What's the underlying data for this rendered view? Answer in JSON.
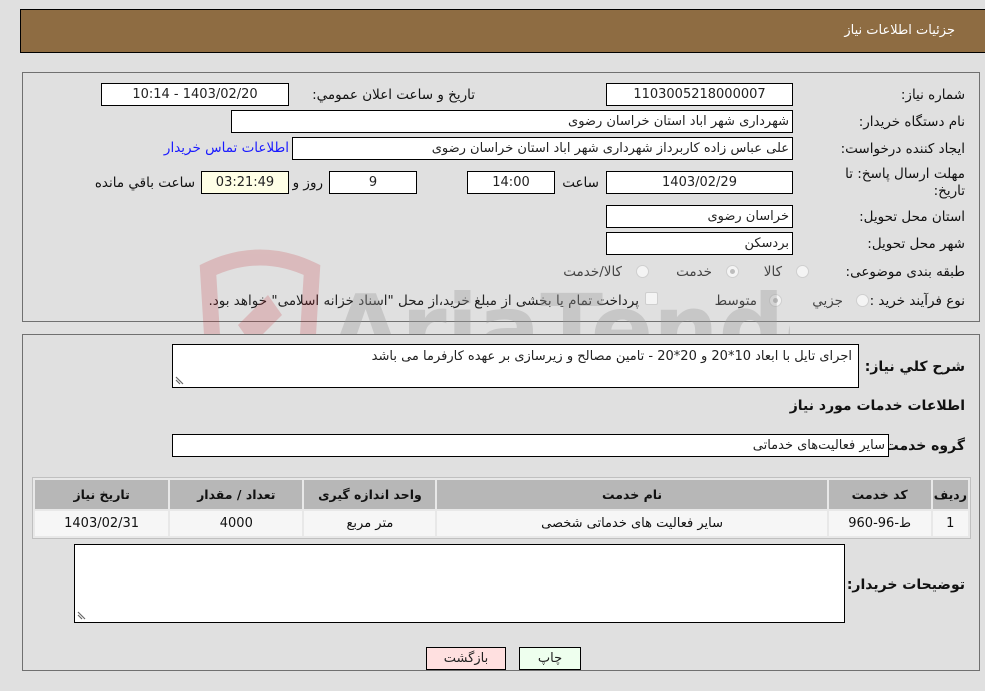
{
  "header": {
    "title": "جزئیات اطلاعات نیاز"
  },
  "form": {
    "need_number": {
      "label": "شماره نیاز:",
      "value": "1103005218000007"
    },
    "announce": {
      "label": "تاریخ و ساعت اعلان عمومي:",
      "value": "1403/02/20 - 10:14"
    },
    "buyer_org": {
      "label": "نام دستگاه خريدار:",
      "value": "شهرداری شهر اباد استان خراسان رضوی"
    },
    "creator": {
      "label": "ایجاد کننده درخواست:",
      "value": "علی عباس زاده کاربرداز شهرداری شهر اباد استان خراسان رضوی",
      "contact_link": "اطلاعات تماس خریدار"
    },
    "deadline": {
      "label": "مهلت ارسال پاسخ: تا تاریخ:",
      "date": "1403/02/29",
      "time_label": "ساعت",
      "time": "14:00",
      "days": "9",
      "days_label": "روز و",
      "remaining": "03:21:49",
      "remaining_label": "ساعت باقي مانده"
    },
    "delivery_province": {
      "label": "استان محل تحویل:",
      "value": "خراسان رضوی"
    },
    "delivery_city": {
      "label": "شهر محل تحویل:",
      "value": "بردسکن"
    },
    "category": {
      "label": "طبقه بندی موضوعی:",
      "options": [
        "کالا",
        "خدمت",
        "کالا/خدمت"
      ],
      "selected": "خدمت"
    },
    "purchase_type": {
      "label": "نوع فرآیند خرید :",
      "options": [
        "جزيي",
        "متوسط"
      ],
      "selected": "متوسط",
      "treasury_note": "پرداخت تمام یا بخشی از مبلغ خرید،از محل \"اسناد خزانه اسلامی\" خواهد بود."
    }
  },
  "details": {
    "description_label": "شرح کلي نياز:",
    "description": "اجرای تایل با ابعاد 10*20 و 20*20 - تامین مصالح و زیرسازی بر عهده کارفرما می باشد",
    "services_heading": "اطلاعات خدمات مورد نياز",
    "service_group_label": "گروه خدمت:",
    "service_group": "سایر فعالیت‌های خدماتی",
    "table": {
      "headers": [
        "ردیف",
        "کد خدمت",
        "نام خدمت",
        "واحد اندازه گیری",
        "تعداد / مقدار",
        "تاریخ نیاز"
      ],
      "rows": [
        [
          "1",
          "ط-96-960",
          "سایر فعالیت های خدماتی شخصی",
          "متر مربع",
          "4000",
          "1403/02/31"
        ]
      ]
    },
    "buyer_notes_label": "توضیحات خریدار:",
    "buyer_notes": ""
  },
  "buttons": {
    "print": "چاپ",
    "back": "بازگشت"
  },
  "watermark": {
    "text": "AriaTender.neT"
  },
  "colors": {
    "header": "#8e6c42",
    "link": "#1a1aff",
    "back_btn": "#ffe0e0",
    "print_btn": "#eeffee",
    "timer_bg": "#ffffe6"
  }
}
